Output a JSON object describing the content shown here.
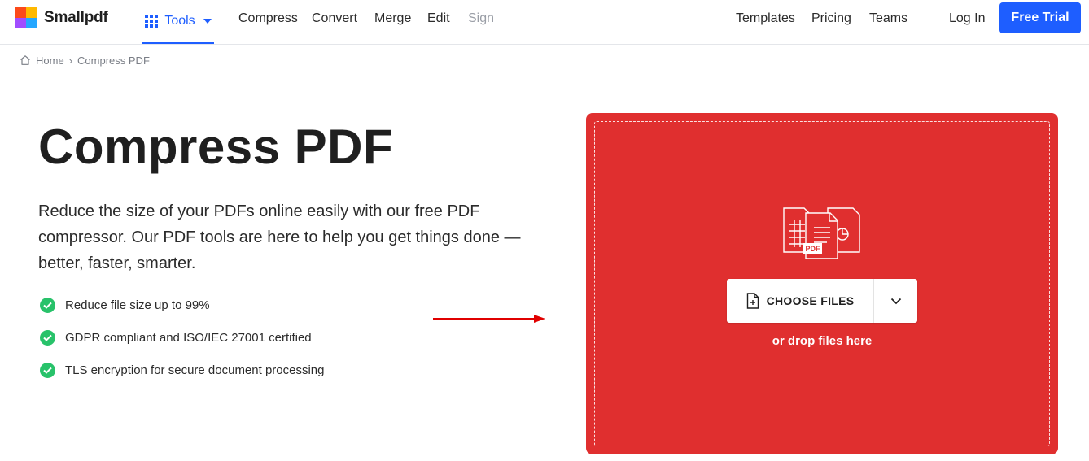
{
  "brand": {
    "name": "Smallpdf",
    "logo_colors": [
      "#fc4a1a",
      "#ffb900",
      "#a14dff",
      "#25a7ff"
    ]
  },
  "nav": {
    "tools_label": "Tools",
    "links": [
      "Compress",
      "Convert",
      "Merge",
      "Edit",
      "Sign"
    ],
    "right_links": [
      "Templates",
      "Pricing",
      "Teams"
    ],
    "login_label": "Log In",
    "trial_label": "Free Trial"
  },
  "breadcrumb": {
    "home": "Home",
    "separator": "›",
    "current": "Compress PDF"
  },
  "hero": {
    "title": "Compress PDF",
    "description": "Reduce the size of your PDFs online easily with our free PDF compressor. Our PDF tools are here to help you get things done —better, faster, smarter.",
    "features": [
      "Reduce file size up to 99%",
      "GDPR compliant and ISO/IEC 27001 certified",
      "TLS encryption for secure document processing"
    ]
  },
  "dropzone": {
    "illustration_badge": "PDF",
    "choose_label": "CHOOSE FILES",
    "drop_hint": "or drop files here"
  },
  "colors": {
    "accent": "#1e5eff",
    "dropzone": "#e02f2f",
    "check": "#28c26a",
    "arrow": "#e00000"
  }
}
